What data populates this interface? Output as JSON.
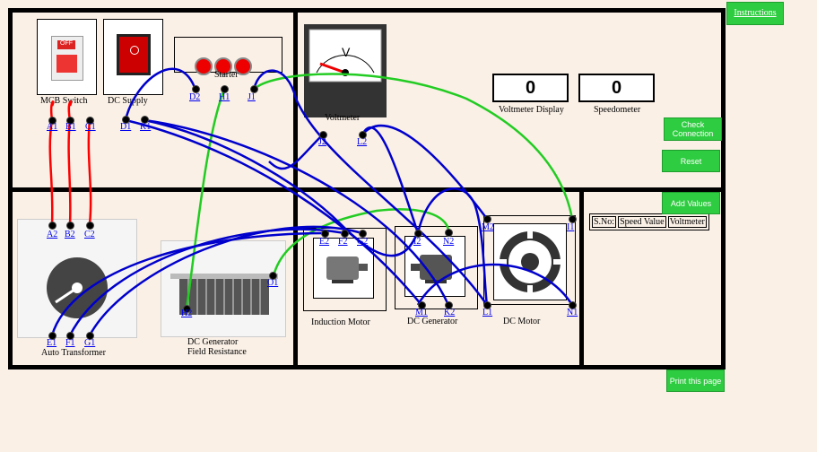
{
  "buttons": {
    "instructions": "Instructions",
    "check_connection": "Check Connection",
    "reset": "Reset",
    "add_values": "Add Values",
    "print": "Print this page"
  },
  "devices": {
    "mcb_label": "MCB Switch",
    "mcb_switch_text": "OFF",
    "dc_supply_label": "DC Supply",
    "starter_label": "Starter",
    "voltmeter_label": "Voltmeter",
    "voltmeter_symbol": "V",
    "auto_transformer_label": "Auto Transformer",
    "field_resistance_label_1": "DC Generator",
    "field_resistance_label_2": "Field Resistance",
    "induction_motor_label": "Induction Motor",
    "dc_generator_label": "DC Generator",
    "dc_motor_label": "DC Motor"
  },
  "displays": {
    "voltmeter_value": "0",
    "voltmeter_caption": "Voltmeter Display",
    "speedometer_value": "0",
    "speedometer_caption": "Speedometer"
  },
  "table": {
    "headers": [
      "S.No:",
      "Speed Value",
      "Voltmeter"
    ]
  },
  "terminals": {
    "A1": "A1",
    "B1": "B1",
    "C1": "C1",
    "D1": "D1",
    "K1": "K1",
    "D2": "D2",
    "H1": "H1",
    "J1": "J1",
    "J2": "J2",
    "L2": "L2",
    "A2": "A2",
    "B2": "B2",
    "C2": "C2",
    "E1": "E1",
    "F1": "F1",
    "G1": "G1",
    "H2": "H2",
    "O1": "O1",
    "E2": "E2",
    "F2": "F2",
    "G2": "G2",
    "I2": "I2",
    "N2": "N2",
    "M1": "M1",
    "K2": "K2",
    "M2": "M2",
    "I1": "I1",
    "L1": "L1",
    "N1": "N1"
  },
  "colors": {
    "button_green": "#2ecc40",
    "wire_red": "#ff0000",
    "wire_blue": "#0000cc",
    "wire_green": "#22cc22"
  }
}
